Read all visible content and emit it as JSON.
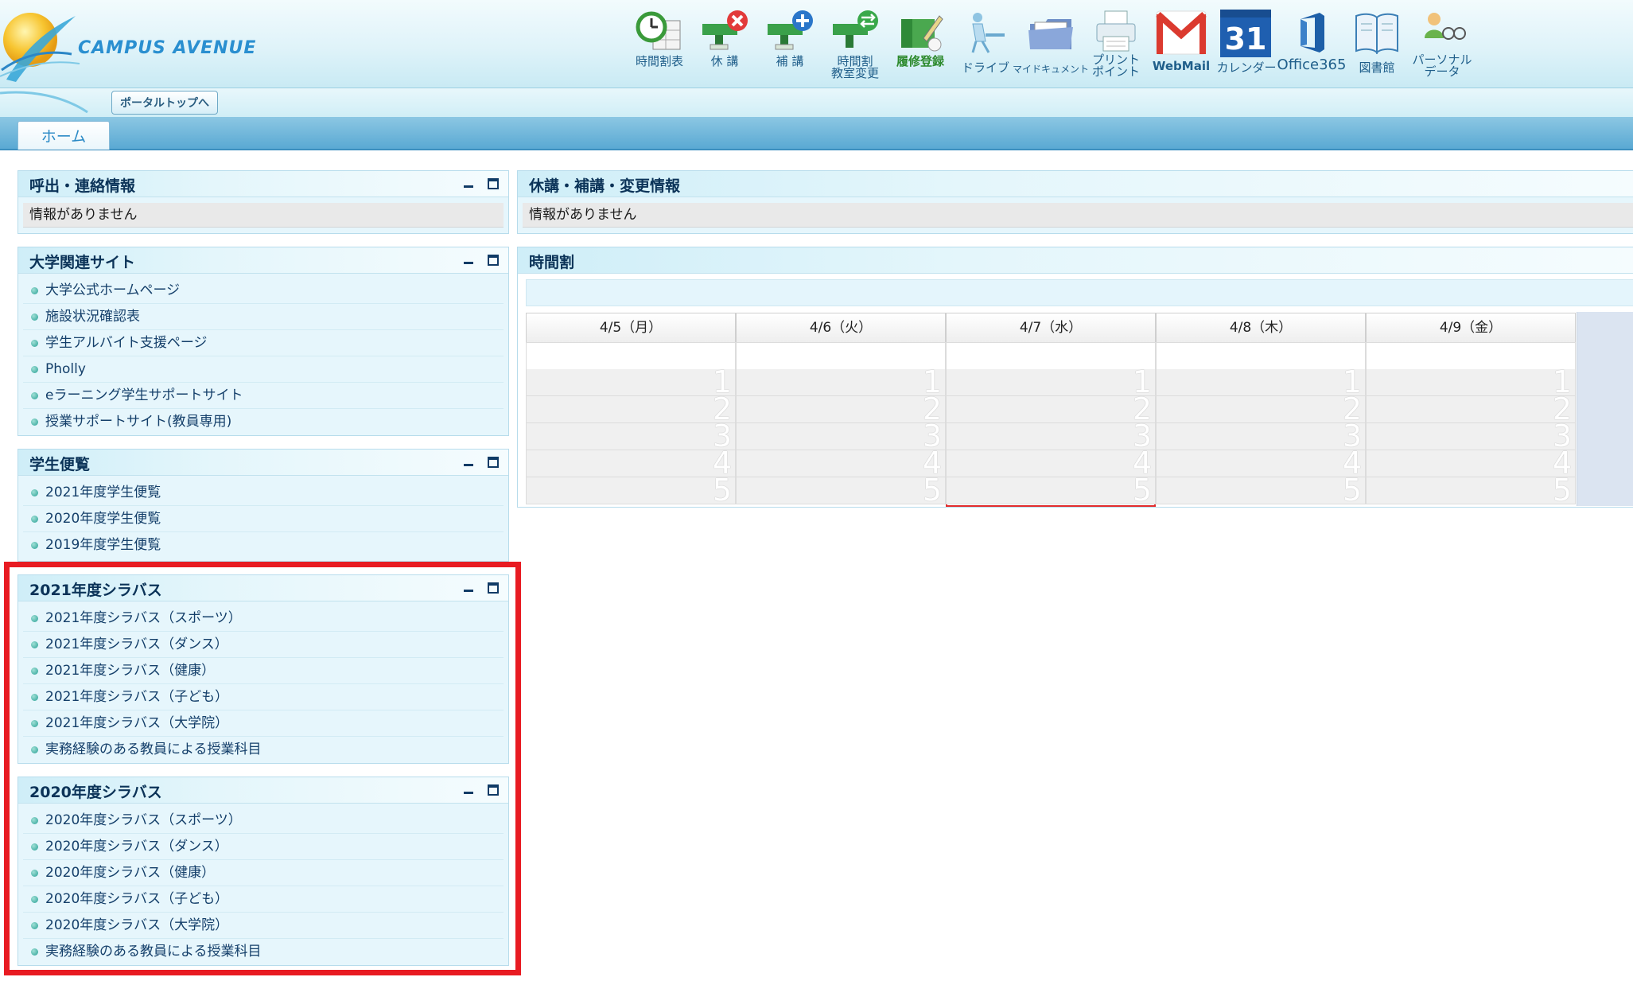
{
  "header": {
    "logo_text": "CAMPUS AVENUE",
    "portal_button": "ポータルトップへ",
    "toolbar": [
      {
        "label": "時間割表",
        "icon": "timetable-icon"
      },
      {
        "label": "休 講",
        "icon": "class-cancel-icon"
      },
      {
        "label": "補 講",
        "icon": "makeup-class-icon"
      },
      {
        "label": "時間割\n教室変更",
        "icon": "room-change-icon"
      },
      {
        "label": "履修登録",
        "icon": "course-registration-icon"
      },
      {
        "label": "ドライブ",
        "icon": "drive-icon"
      },
      {
        "label": "マイドキュメント",
        "icon": "my-documents-icon"
      },
      {
        "label": "プリント\nポイント",
        "icon": "print-point-icon"
      },
      {
        "label": "WebMail",
        "icon": "gmail-icon"
      },
      {
        "label": "カレンダー",
        "icon": "calendar-icon",
        "number": "31"
      },
      {
        "label": "Office365",
        "icon": "office365-icon"
      },
      {
        "label": "図書館",
        "icon": "library-icon"
      },
      {
        "label": "パーソナル\nデータ",
        "icon": "personal-data-icon"
      }
    ]
  },
  "tabs": {
    "home": "ホーム"
  },
  "panels": {
    "contact": {
      "title": "呼出・連絡情報",
      "message": "情報がありません"
    },
    "university_sites": {
      "title": "大学関連サイト",
      "items": [
        "大学公式ホームページ",
        "施設状況確認表",
        "学生アルバイト支援ページ",
        "Pholly",
        "eラーニング学生サポートサイト",
        "授業サポートサイト(教員専用)"
      ]
    },
    "handbook": {
      "title": "学生便覧",
      "items": [
        "2021年度学生便覧",
        "2020年度学生便覧",
        "2019年度学生便覧"
      ]
    },
    "syllabus_2021": {
      "title": "2021年度シラバス",
      "items": [
        "2021年度シラバス（スポーツ）",
        "2021年度シラバス（ダンス）",
        "2021年度シラバス（健康）",
        "2021年度シラバス（子ども）",
        "2021年度シラバス（大学院）",
        "実務経験のある教員による授業科目"
      ]
    },
    "syllabus_2020": {
      "title": "2020年度シラバス",
      "items": [
        "2020年度シラバス（スポーツ）",
        "2020年度シラバス（ダンス）",
        "2020年度シラバス（健康）",
        "2020年度シラバス（子ども）",
        "2020年度シラバス（大学院）",
        "実務経験のある教員による授業科目"
      ]
    },
    "changes": {
      "title": "休講・補講・変更情報",
      "message": "情報がありません"
    },
    "timetable": {
      "title": "時間割",
      "days": [
        "4/5（月）",
        "4/6（火）",
        "4/7（水）",
        "4/8（木）",
        "4/9（金）"
      ],
      "today_index": 2,
      "periods": [
        "1",
        "2",
        "3",
        "4",
        "5"
      ]
    }
  },
  "colors": {
    "highlight": "#e81b22",
    "accent": "#2b8ac6"
  }
}
